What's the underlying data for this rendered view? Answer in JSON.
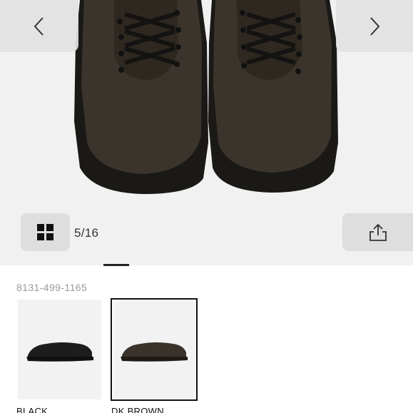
{
  "gallery": {
    "current_index": "5/16",
    "prev_icon": "chevron-left-icon",
    "next_icon": "chevron-right-icon",
    "grid_icon": "grid-icon",
    "share_icon": "share-icon"
  },
  "product": {
    "sku": "8131-499-1165"
  },
  "colors": {
    "options": [
      {
        "label": "BLACK",
        "selected": false,
        "swatch": "#1d1d1d"
      },
      {
        "label": "DK BROWN",
        "selected": true,
        "swatch": "#3a332b"
      }
    ]
  }
}
